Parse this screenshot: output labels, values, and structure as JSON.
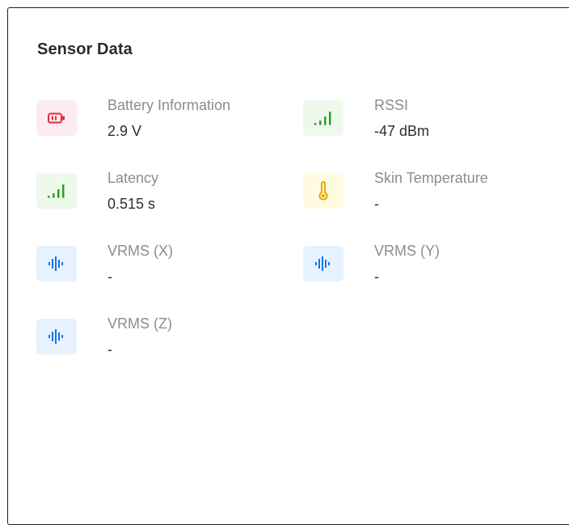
{
  "card": {
    "title": "Sensor Data"
  },
  "sensors": [
    {
      "label": "Battery Information",
      "value": "2.9 V",
      "icon": "battery-icon",
      "icon_color": "#e2283c",
      "icon_bg": "#fdecef"
    },
    {
      "label": "RSSI",
      "value": "-47 dBm",
      "icon": "signal-bars-icon",
      "icon_color": "#2e9d2e",
      "icon_bg": "#eef9ec"
    },
    {
      "label": "Latency",
      "value": "0.515 s",
      "icon": "signal-bars-icon",
      "icon_color": "#2e9d2e",
      "icon_bg": "#eef9ec"
    },
    {
      "label": "Skin Temperature",
      "value": "-",
      "icon": "thermometer-icon",
      "icon_color": "#e0a800",
      "icon_bg": "#fffbe0"
    },
    {
      "label": "VRMS (X)",
      "value": "-",
      "icon": "waveform-icon",
      "icon_color": "#1a73e8",
      "icon_bg": "#e6f2fd"
    },
    {
      "label": "VRMS (Y)",
      "value": "-",
      "icon": "waveform-icon",
      "icon_color": "#1a73e8",
      "icon_bg": "#e6f2fd"
    },
    {
      "label": "VRMS (Z)",
      "value": "-",
      "icon": "waveform-icon",
      "icon_color": "#1a73e8",
      "icon_bg": "#e6f2fd"
    }
  ]
}
